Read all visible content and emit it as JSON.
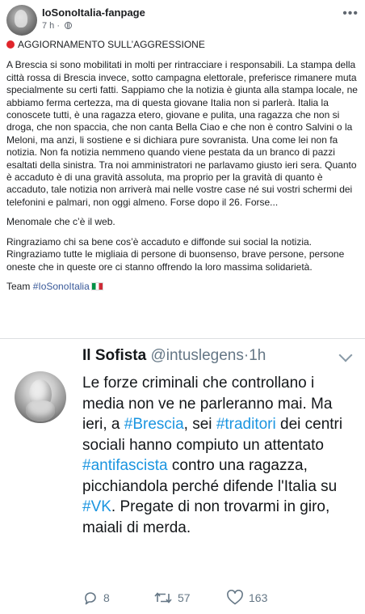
{
  "post": {
    "page_name": "IoSonoItalia-fanpage",
    "time": "7 h",
    "headline": "AGGIORNAMENTO SULL’AGGRESSIONE",
    "paragraph1": "A Brescia si sono mobilitati in molti per rintracciare i responsabili. La stampa della città rossa di Brescia invece, sotto campagna elettorale, preferisce rimanere muta specialmente su certi fatti. Sappiamo che la notizia è giunta alla stampa locale, ne abbiamo ferma certezza, ma di questa giovane Italia non si parlerà. Italia la conoscete tutti, è una ragazza etero, giovane e pulita, una ragazza che non si droga, che non spaccia, che non canta Bella Ciao e che non è contro Salvini o la Meloni, ma anzi, li sostiene e si dichiara pure sovranista. Una come lei non fa notizia. Non fa notizia nemmeno quando viene pestata da un branco di pazzi esaltati della sinistra. Tra noi amministratori ne parlavamo giusto ieri sera. Quanto è accaduto è di una gravità assoluta, ma proprio per la gravità di quanto è accaduto, tale notizia non arriverà mai nelle vostre case né sui vostri schermi dei telefonini e palmari, non oggi almeno. Forse dopo il 26. Forse...",
    "paragraph2": "Menomale che c’è il web.",
    "paragraph3": "Ringraziamo chi sa bene cos’è accaduto e diffonde sui social la notizia. Ringraziamo tutte le migliaia di persone di buonsenso, brave persone, persone oneste che in queste ore ci stanno offrendo la loro massima solidarietà.",
    "team_prefix": "Team",
    "team_hashtag": "#IoSonoItalia"
  },
  "tweet": {
    "name": "Il Sofista",
    "handle": "@intuslegens",
    "separator": "·",
    "time": "1h",
    "body_1": "Le forze criminali che controllano i media non ve ne parleranno mai. Ma ieri, a",
    "tag_brescia": "#Brescia",
    "body_2": ", sei",
    "tag_traditori": "#traditori",
    "body_3": "dei centri sociali hanno compiuto un attentato",
    "tag_antifascista": "#antifascista",
    "body_4": "contro una ragazza, picchiandola perché difende l'Italia su",
    "tag_vk": "#VK",
    "body_5": ". Pregate di non trovarmi in giro, maiali di merda.",
    "replies": "8",
    "retweets": "57",
    "likes": "163"
  },
  "colors": {
    "fb_link": "#385898",
    "twitter_link": "#1b95e0",
    "alert_red": "#e0252b",
    "muted": "#657786"
  },
  "icons": {
    "header_more": "more-dots-icon",
    "privacy": "globe-icon",
    "alert": "red-circle-icon",
    "flag": "italy-flag-icon",
    "reply": "reply-bubble-icon",
    "retweet": "retweet-icon",
    "like": "heart-icon",
    "tweet_menu": "chevron-down-icon"
  }
}
